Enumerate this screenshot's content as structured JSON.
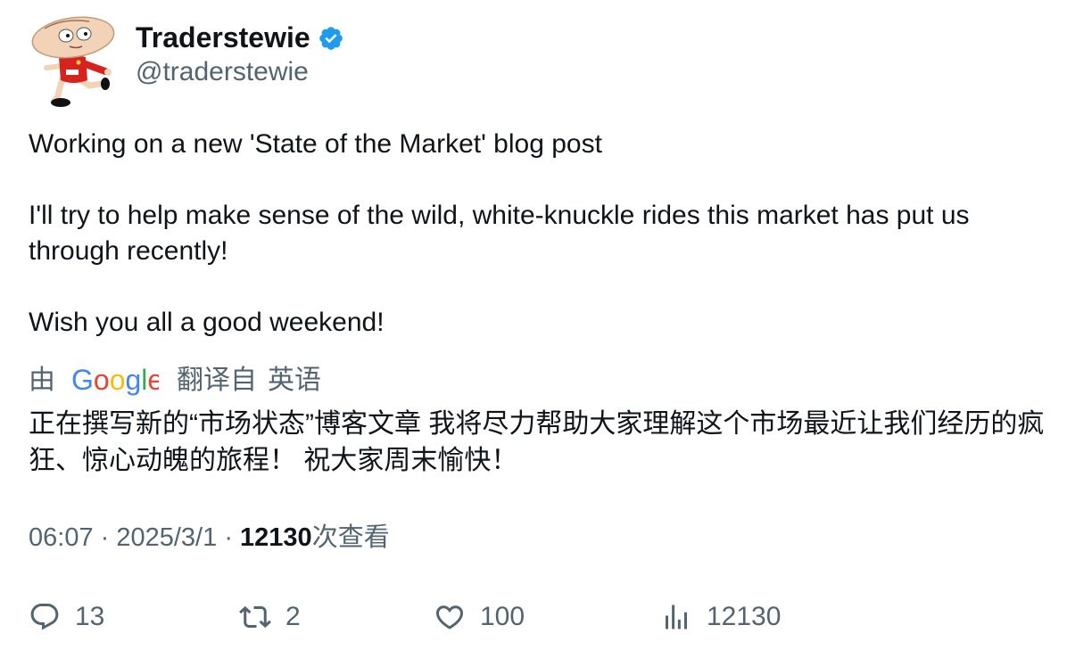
{
  "user": {
    "display_name": "Traderstewie",
    "handle": "@traderstewie",
    "avatar_icon": "stewie-avatar-icon",
    "verified_icon": "verified-badge-icon",
    "verified_color": "#1d9bf0"
  },
  "tweet": {
    "line1": "Working on a new 'State of the Market' blog post",
    "line2": "I'll try to help make sense of the wild, white-knuckle rides this market has put us through recently!",
    "line3": "Wish you all a good weekend!"
  },
  "translation": {
    "by_label": "由",
    "provider": "Google",
    "from_label": "翻译自",
    "language": "英语",
    "text": "正在撰写新的“市场状态”博客文章 我将尽力帮助大家理解这个市场最近让我们经历的疯狂、惊心动魄的旅程！ 祝大家周末愉快！"
  },
  "meta": {
    "time": "06:07",
    "date": "2025/3/1",
    "views_count": "12130",
    "views_label": "次查看"
  },
  "actions": {
    "replies": "13",
    "retweets": "2",
    "likes": "100",
    "views": "12130"
  }
}
